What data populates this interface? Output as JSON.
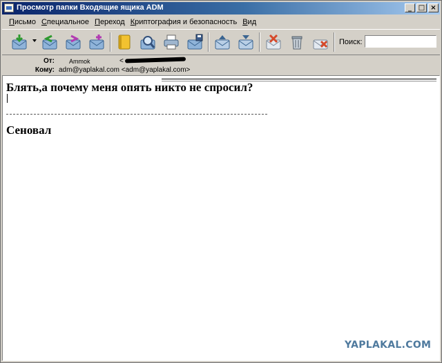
{
  "window": {
    "title": "Просмотр папки Входящие ящика ADM"
  },
  "menu": [
    "Письмо",
    "Специальное",
    "Переход",
    "Криптография и безопасность",
    "Вид"
  ],
  "menu_access_keys": [
    "П",
    "С",
    "П",
    "К",
    "В"
  ],
  "titlebar_buttons": {
    "minimize": "_",
    "maximize": "□",
    "close": "×"
  },
  "toolbar": {
    "tools": [
      "get-mail-icon",
      "reply-icon",
      "forward-icon",
      "compose-icon",
      "address-book-icon",
      "find-icon",
      "print-icon",
      "save-icon",
      "prev-message-icon",
      "next-message-icon",
      "junk-icon",
      "delete-icon",
      "mark-icon"
    ],
    "search_label": "Поиск:",
    "search_value": ""
  },
  "header": {
    "from_label": "От:",
    "from_name": "Ammok",
    "from_address": "<",
    "to_label": "Кому:",
    "to_value": "adm@yaplakal.com <adm@yaplakal.com>"
  },
  "message": {
    "line1": "Блять,а почему меня опять никто не спросил?",
    "signature": "Сеновал"
  },
  "watermark": "YAPLAKAL.COM",
  "colors": {
    "titlebar_start": "#0a246a",
    "titlebar_end": "#a6caf0",
    "chrome": "#d4d0c8",
    "watermark": "#4f7a9e"
  }
}
